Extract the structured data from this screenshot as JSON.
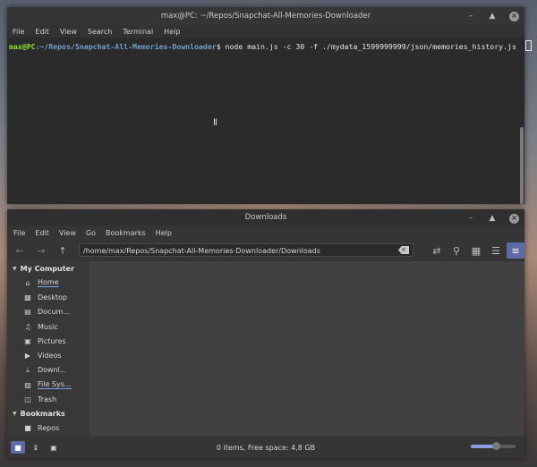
{
  "terminal": {
    "title": "max@PC: ~/Repos/Snapchat-All-Memories-Downloader",
    "menu": [
      "File",
      "Edit",
      "View",
      "Search",
      "Terminal",
      "Help"
    ],
    "prompt_user": "max@PC",
    "prompt_path": ":~/Repos/Snapchat-All-Memories-Downloader",
    "prompt_symbol": "$ ",
    "command": "node main.js -c 30 -f ./mydata_1599999999/json/memories_history.json"
  },
  "files": {
    "title": "Downloads",
    "menu": [
      "File",
      "Edit",
      "View",
      "Go",
      "Bookmarks",
      "Help"
    ],
    "path": "/home/max/Repos/Snapchat-All-Memories-Downloader/Downloads",
    "sidebar": {
      "my_computer": "My Computer",
      "items": [
        {
          "label": "Home",
          "icon": "home-icon"
        },
        {
          "label": "Desktop",
          "icon": "desktop-icon"
        },
        {
          "label": "Docum...",
          "icon": "documents-icon"
        },
        {
          "label": "Music",
          "icon": "music-icon"
        },
        {
          "label": "Pictures",
          "icon": "pictures-icon"
        },
        {
          "label": "Videos",
          "icon": "videos-icon"
        },
        {
          "label": "Downl...",
          "icon": "downloads-icon"
        },
        {
          "label": "File Sys...",
          "icon": "filesystem-icon"
        },
        {
          "label": "Trash",
          "icon": "trash-icon"
        }
      ],
      "bookmarks": "Bookmarks",
      "bookmark_items": [
        {
          "label": "Repos",
          "icon": "folder-icon"
        }
      ]
    },
    "status": "0 items, Free space: 4,8 GB",
    "zoom_level": 0.55
  }
}
